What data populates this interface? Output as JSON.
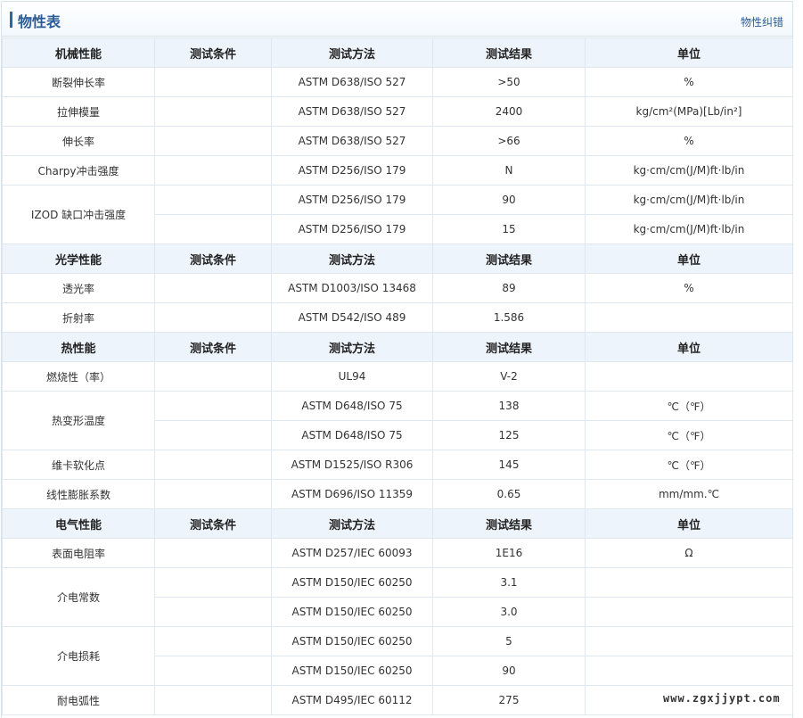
{
  "header": {
    "title": "物性表",
    "report_link": "物性纠错"
  },
  "columns": [
    "测试条件",
    "测试方法",
    "测试结果",
    "单位"
  ],
  "sections": [
    {
      "name": "机械性能",
      "props": [
        {
          "name": "断裂伸长率",
          "rows": [
            {
              "method": "ASTM D638/ISO 527",
              "result": ">50",
              "unit": "%"
            }
          ]
        },
        {
          "name": "拉伸模量",
          "rows": [
            {
              "method": "ASTM D638/ISO 527",
              "result": "2400",
              "unit": "kg/cm²(MPa)[Lb/in²]"
            }
          ]
        },
        {
          "name": "伸长率",
          "rows": [
            {
              "method": "ASTM D638/ISO 527",
              "result": ">66",
              "unit": "%"
            }
          ]
        },
        {
          "name": "Charpy冲击强度",
          "rows": [
            {
              "method": "ASTM D256/ISO 179",
              "result": "N",
              "unit": "kg·cm/cm(J/M)ft·lb/in"
            }
          ]
        },
        {
          "name": "IZOD 缺口冲击强度",
          "rows": [
            {
              "method": "ASTM D256/ISO 179",
              "result": "90",
              "unit": "kg·cm/cm(J/M)ft·lb/in"
            },
            {
              "method": "ASTM D256/ISO 179",
              "result": "15",
              "unit": "kg·cm/cm(J/M)ft·lb/in"
            }
          ]
        }
      ]
    },
    {
      "name": "光学性能",
      "props": [
        {
          "name": "透光率",
          "rows": [
            {
              "method": "ASTM D1003/ISO 13468",
              "result": "89",
              "unit": "%"
            }
          ]
        },
        {
          "name": "折射率",
          "rows": [
            {
              "method": "ASTM D542/ISO 489",
              "result": "1.586",
              "unit": ""
            }
          ]
        }
      ]
    },
    {
      "name": "热性能",
      "props": [
        {
          "name": "燃烧性（率）",
          "rows": [
            {
              "method": "UL94",
              "result": "V-2",
              "unit": ""
            }
          ]
        },
        {
          "name": "热变形温度",
          "rows": [
            {
              "method": "ASTM D648/ISO 75",
              "result": "138",
              "unit": "℃（℉）"
            },
            {
              "method": "ASTM D648/ISO 75",
              "result": "125",
              "unit": "℃（℉）"
            }
          ]
        },
        {
          "name": "维卡软化点",
          "rows": [
            {
              "method": "ASTM D1525/ISO R306",
              "result": "145",
              "unit": "℃（℉）"
            }
          ]
        },
        {
          "name": "线性膨胀系数",
          "rows": [
            {
              "method": "ASTM D696/ISO 11359",
              "result": "0.65",
              "unit": "mm/mm.℃"
            }
          ]
        }
      ]
    },
    {
      "name": "电气性能",
      "props": [
        {
          "name": "表面电阻率",
          "rows": [
            {
              "method": "ASTM D257/IEC 60093",
              "result": "1E16",
              "unit": "Ω"
            }
          ]
        },
        {
          "name": "介电常数",
          "rows": [
            {
              "method": "ASTM D150/IEC 60250",
              "result": "3.1",
              "unit": ""
            },
            {
              "method": "ASTM D150/IEC 60250",
              "result": "3.0",
              "unit": ""
            }
          ]
        },
        {
          "name": "介电损耗",
          "rows": [
            {
              "method": "ASTM D150/IEC 60250",
              "result": "5",
              "unit": ""
            },
            {
              "method": "ASTM D150/IEC 60250",
              "result": "90",
              "unit": ""
            }
          ]
        },
        {
          "name": "耐电弧性",
          "rows": [
            {
              "method": "ASTM D495/IEC 60112",
              "result": "275",
              "unit": ""
            }
          ]
        }
      ]
    }
  ],
  "watermark": "www.zgxjjypt.com"
}
